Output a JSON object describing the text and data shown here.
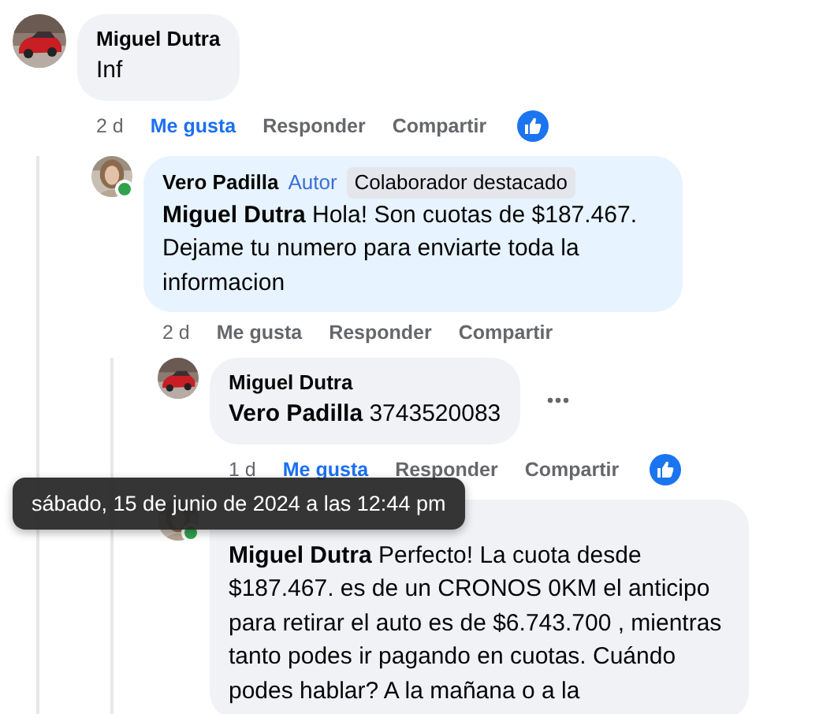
{
  "comments": [
    {
      "author": "Miguel Dutra",
      "avatar": {
        "kind": "picture"
      },
      "text": "Inf",
      "time": "2 d",
      "time_hovered": false,
      "liked": true,
      "reacted": true,
      "actions": {
        "like": "Me gusta",
        "reply": "Responder",
        "share": "Compartir"
      },
      "replies": [
        {
          "author": "Vero Padilla",
          "avatar": {
            "kind": "picture"
          },
          "online": true,
          "highlighted": true,
          "text": "**Miguel Dutra** Hola! Son cuotas de $187.467. Dejame tu numero para enviarte toda la informacion",
          "time": "2 d",
          "time_hovered": false,
          "liked": false,
          "badges": [
            {
              "label": "Autor",
              "kind": "author"
            },
            {
              "label": "Colaborador destacado",
              "kind": "tag"
            }
          ],
          "actions": {
            "like": "Me gusta",
            "reply": "Responder",
            "share": "Compartir"
          },
          "replies": [
            {
              "author": "Miguel Dutra",
              "avatar": {
                "kind": "picture"
              },
              "text": "**Vero Padilla** 3743520083",
              "time": "1 d",
              "time_hovered": true,
              "liked": true,
              "reacted": true,
              "more": true,
              "actions": {
                "like": "Me gusta",
                "reply": "Responder",
                "share": "Compartir"
              }
            },
            {
              "avatar": {
                "kind": "picture"
              },
              "online": true,
              "text": "**Miguel Dutra** Perfecto! La cuota desde $187.467. es de un CRONOS 0KM el anticipo para retirar el auto es de $6.743.700 , mientras tanto podes ir pagando en cuotas. Cuándo podes hablar? A la mañana o a la"
            }
          ]
        }
      ]
    }
  ],
  "tooltip": {
    "text": "sábado, 15 de junio de 2024 a las 12:44 pm"
  }
}
